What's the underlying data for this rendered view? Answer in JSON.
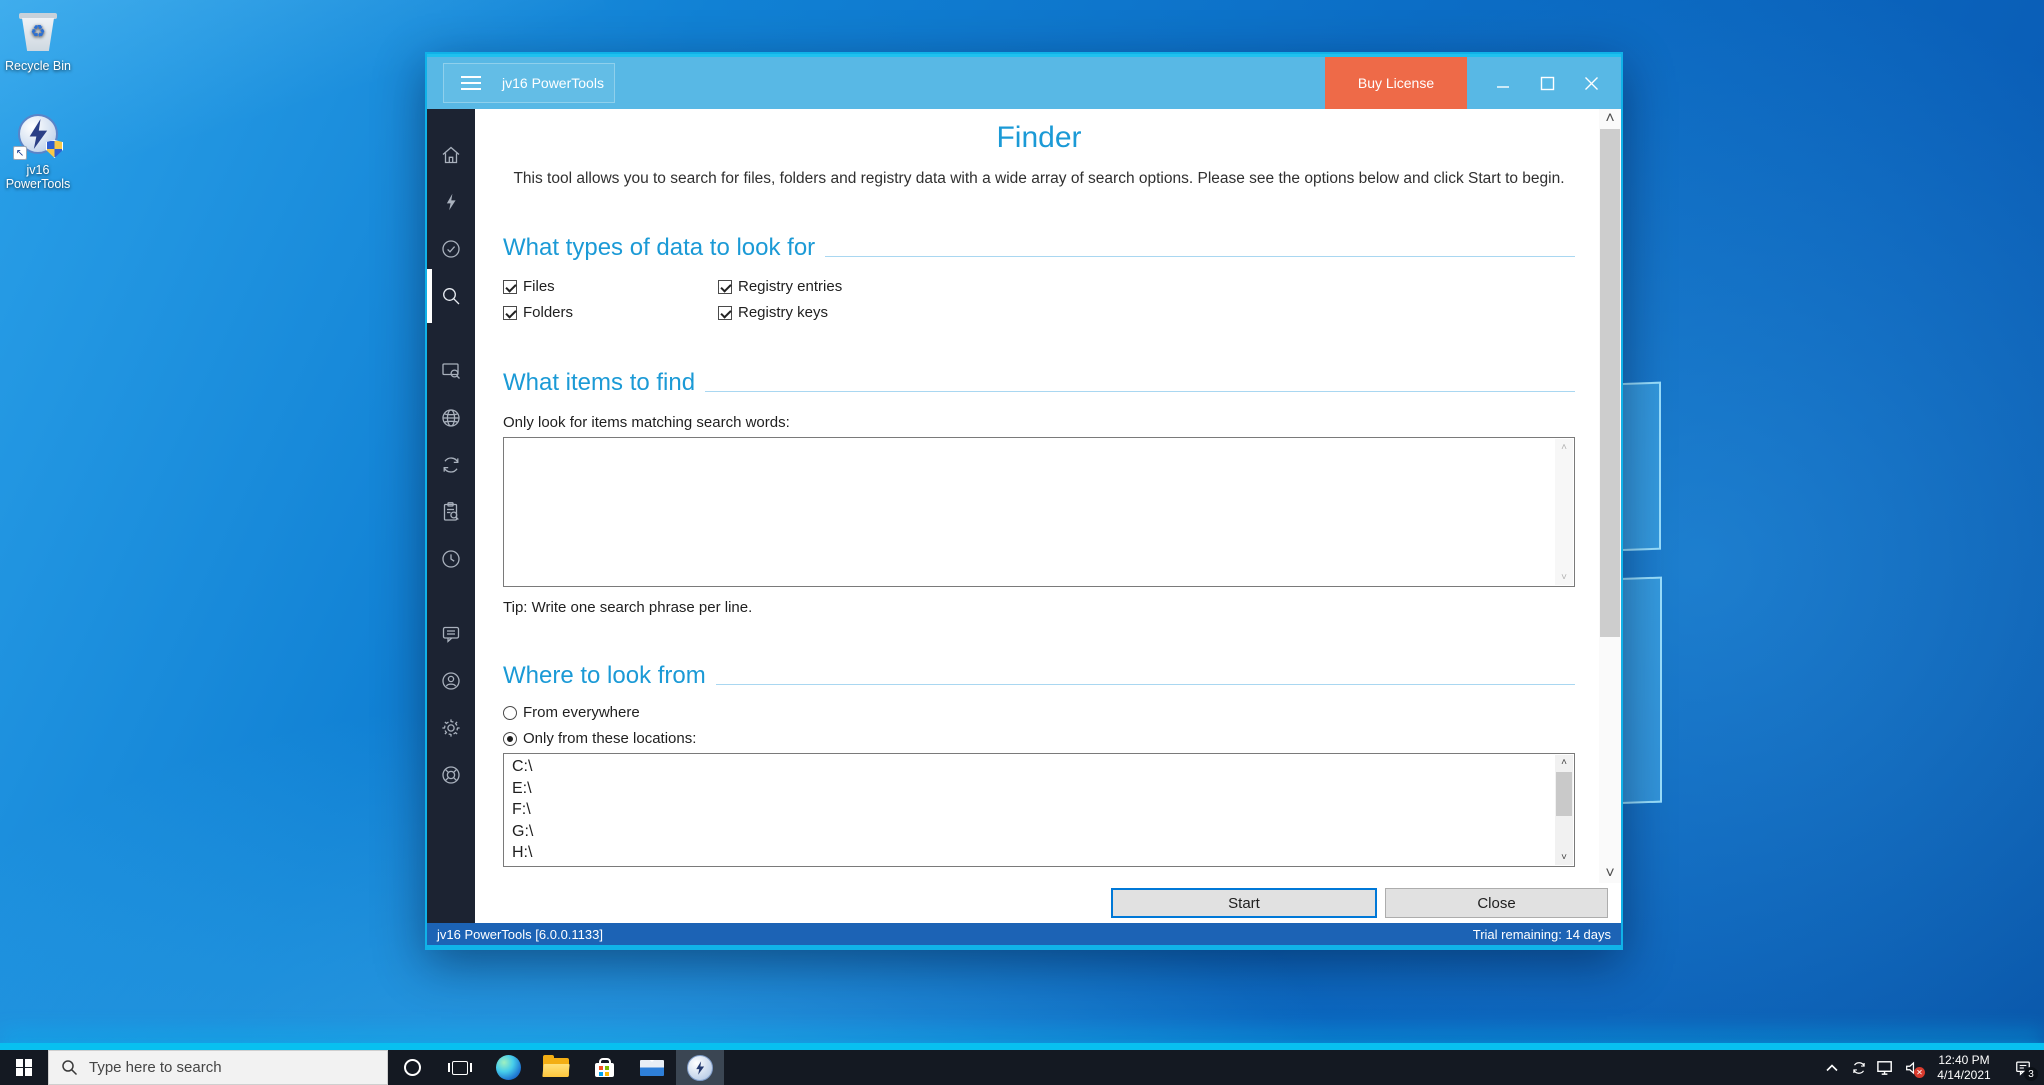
{
  "desktop": {
    "icons": [
      {
        "label": "Recycle Bin"
      },
      {
        "label": "jv16 PowerTools"
      }
    ]
  },
  "window": {
    "titlebar": {
      "title": "jv16 PowerTools",
      "buy_license": "Buy License"
    },
    "sidebar": {
      "items": [
        "home",
        "clean-and-fix",
        "verify",
        "finder",
        "software-finder",
        "internet",
        "refresh",
        "tasks",
        "history",
        "feedback",
        "account",
        "settings",
        "support"
      ],
      "active": "finder"
    },
    "finder": {
      "title": "Finder",
      "description": "This tool allows you to search for files, folders and registry data with a wide array of search options. Please see the options below and click Start to begin.",
      "types": {
        "heading": "What types of data to look for",
        "options": [
          {
            "label": "Files",
            "checked": true
          },
          {
            "label": "Folders",
            "checked": true
          },
          {
            "label": "Registry entries",
            "checked": true
          },
          {
            "label": "Registry keys",
            "checked": true
          }
        ]
      },
      "items": {
        "heading": "What items to find",
        "label": "Only look for items matching search words:",
        "value": "",
        "tip": "Tip: Write one search phrase per line."
      },
      "where": {
        "heading": "Where to look from",
        "options": [
          {
            "label": "From everywhere",
            "selected": false
          },
          {
            "label": "Only from these locations:",
            "selected": true
          }
        ],
        "locations": [
          "C:\\",
          "E:\\",
          "F:\\",
          "G:\\",
          "H:\\"
        ]
      },
      "buttons": {
        "start": "Start",
        "close": "Close"
      }
    },
    "statusbar": {
      "left": "jv16 PowerTools [6.0.0.1133]",
      "right": "Trial remaining: 14 days"
    }
  },
  "taskbar": {
    "search_placeholder": "Type here to search",
    "tray": {
      "time": "12:40 PM",
      "date": "4/14/2021",
      "notification_count": "3"
    }
  }
}
